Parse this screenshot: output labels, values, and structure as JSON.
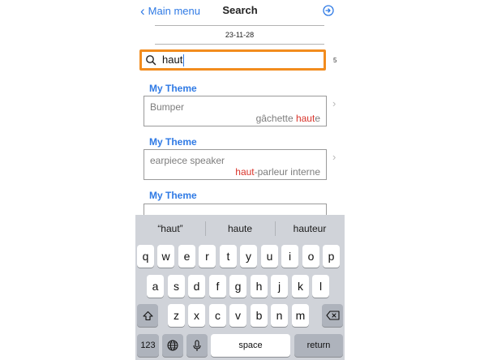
{
  "nav": {
    "back_label": "Main menu",
    "title": "Search",
    "icon": "circle-arrow-icon"
  },
  "date": "23-11-28",
  "search": {
    "value": "haut",
    "result_count": "5"
  },
  "results": [
    {
      "theme": "My Theme",
      "source": "Bumper",
      "target_before": "gâchette ",
      "target_match": "haut",
      "target_after": "e"
    },
    {
      "theme": "My Theme",
      "source": "earpiece speaker",
      "target_before": "",
      "target_match": "haut",
      "target_after": "-parleur interne"
    },
    {
      "theme": "My Theme"
    }
  ],
  "predictions": [
    "“haut”",
    "haute",
    "hauteur"
  ],
  "keyboard": {
    "row1": [
      "q",
      "w",
      "e",
      "r",
      "t",
      "y",
      "u",
      "i",
      "o",
      "p"
    ],
    "row2": [
      "a",
      "s",
      "d",
      "f",
      "g",
      "h",
      "j",
      "k",
      "l"
    ],
    "row3": [
      "z",
      "x",
      "c",
      "v",
      "b",
      "n",
      "m"
    ],
    "numbers_label": "123",
    "space_label": "space",
    "return_label": "return"
  },
  "colors": {
    "accent": "#2f7ae5",
    "highlight": "#d9342b",
    "search_border": "#f28c1e"
  }
}
